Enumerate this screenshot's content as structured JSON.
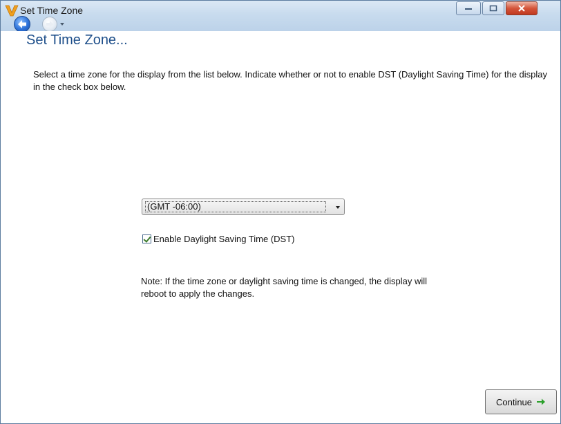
{
  "window": {
    "title": "Set Time Zone"
  },
  "page": {
    "heading": "Set Time Zone...",
    "instructions": "Select a time zone for the display from the list below.  Indicate whether or not to enable DST (Daylight Saving Time) for the display in the check box below."
  },
  "timezone_select": {
    "value": "(GMT -06:00)"
  },
  "dst": {
    "label": "Enable Daylight Saving Time (DST)",
    "checked": true
  },
  "note": "Note: If the time zone or daylight saving time is changed, the display will reboot to apply the changes.",
  "continue_button": {
    "label": "Continue"
  },
  "colors": {
    "heading": "#1e4f8a",
    "titlebar": "#c8dbee",
    "close_button": "#c0391f",
    "continue_arrow": "#2aa02a"
  }
}
